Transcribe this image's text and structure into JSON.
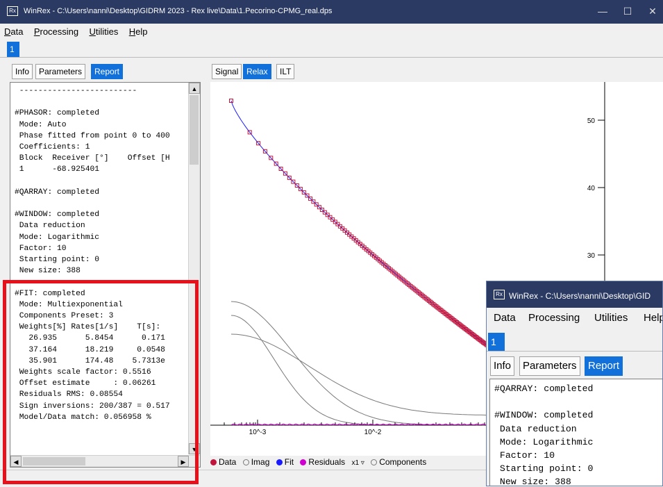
{
  "main_window": {
    "title": "WinRex - C:\\Users\\nanni\\Desktop\\GIDRM 2023 - Rex live\\Data\\1.Pecorino-CPMG_real.dps",
    "app_icon_text": "Rx",
    "controls": {
      "minimize": "—",
      "maximize": "☐",
      "close": "✕"
    },
    "menu": [
      "Data",
      "Processing",
      "Utilities",
      "Help"
    ],
    "block_tab": "1",
    "left_tabs": [
      "Info",
      "Parameters",
      "Report"
    ],
    "left_active_tab": "Report",
    "right_tabs": [
      "Signal",
      "Relax",
      "ILT"
    ],
    "right_active_tab": "Relax",
    "report_lines": [
      " -------------------------",
      "",
      "#PHASOR: completed",
      " Mode: Auto",
      " Phase fitted from point 0 to 400",
      " Coefficients: 1",
      " Block  Receiver [°]    Offset [H",
      " 1      -68.925401",
      "",
      "#QARRAY: completed",
      "",
      "#WINDOW: completed",
      " Data reduction",
      " Mode: Logarithmic",
      " Factor: 10",
      " Starting point: 0",
      " New size: 388",
      "",
      "#FIT: completed",
      " Mode: Multiexponential",
      " Components Preset: 3",
      " Weights[%] Rates[1/s]    T[s]:",
      "   26.935      5.8454      0.171",
      "   37.164      18.219     0.0548",
      "   35.901      174.48    5.7313e",
      " Weights scale factor: 0.5516",
      " Offset estimate     : 0.06261",
      " Residuals RMS: 0.08554",
      " Sign inversions: 200/387 = 0.517",
      " Model/Data match: 0.056958 %"
    ],
    "plot_options": {
      "data": "Data",
      "imag": "Imag",
      "fit": "Fit",
      "residuals": "Residuals",
      "scale": "x1",
      "components": "Components"
    },
    "colors": {
      "titlebar": "#2b3a63",
      "active_tab": "#1170d9",
      "data_marker": "#c0143c",
      "fit_line": "#1a1aff",
      "highlight_frame": "#e8101a"
    }
  },
  "overlay_window": {
    "title": "WinRex - C:\\Users\\nanni\\Desktop\\GID",
    "app_icon_text": "Rx",
    "menu": [
      "Data",
      "Processing",
      "Utilities",
      "Help"
    ],
    "block_tab": "1",
    "tabs": [
      "Info",
      "Parameters",
      "Report"
    ],
    "active_tab": "Report",
    "report_lines": [
      "#QARRAY: completed",
      "",
      "#WINDOW: completed",
      " Data reduction",
      " Mode: Logarithmic",
      " Factor: 10",
      " Starting point: 0",
      " New size: 388"
    ]
  },
  "chart_data": {
    "type": "scatter",
    "x_scale": "log",
    "x_tick_labels": [
      "10^-3",
      "10^-2"
    ],
    "y_tick_labels": [
      "30",
      "40",
      "50"
    ],
    "y_ticks": [
      30,
      40,
      50
    ],
    "series": [
      {
        "name": "Data"
      },
      {
        "name": "Fit"
      },
      {
        "name": "Components"
      },
      {
        "name": "Residuals"
      }
    ]
  }
}
